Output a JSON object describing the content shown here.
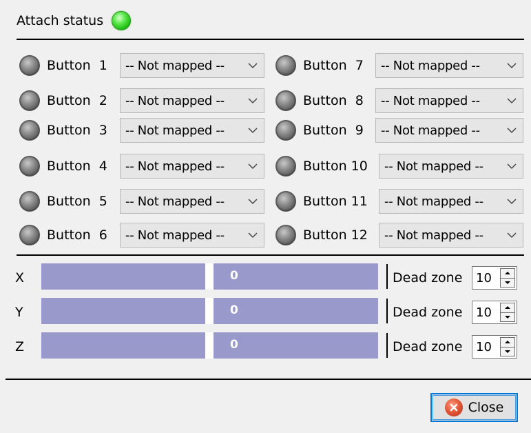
{
  "status": {
    "label": "Attach status",
    "led_color": "#33dd22"
  },
  "buttons_left": [
    {
      "label": "Button  1",
      "mapping": "-- Not mapped --"
    },
    {
      "label": "Button  2",
      "mapping": "-- Not mapped --"
    },
    {
      "label": "Button  3",
      "mapping": "-- Not mapped --"
    },
    {
      "label": "Button  4",
      "mapping": "-- Not mapped --"
    },
    {
      "label": "Button  5",
      "mapping": "-- Not mapped --"
    },
    {
      "label": "Button  6",
      "mapping": "-- Not mapped --"
    }
  ],
  "buttons_right": [
    {
      "label": "Button  7",
      "mapping": "-- Not mapped --"
    },
    {
      "label": "Button  8",
      "mapping": "-- Not mapped --"
    },
    {
      "label": "Button  9",
      "mapping": "-- Not mapped --"
    },
    {
      "label": "Button 10",
      "mapping": "-- Not mapped --"
    },
    {
      "label": "Button 11",
      "mapping": "-- Not mapped --"
    },
    {
      "label": "Button 12",
      "mapping": "-- Not mapped --"
    }
  ],
  "axes": [
    {
      "label": "X",
      "value": "0",
      "dead_zone_label": "Dead zone",
      "dead_zone": "10"
    },
    {
      "label": "Y",
      "value": "0",
      "dead_zone_label": "Dead zone",
      "dead_zone": "10"
    },
    {
      "label": "Z",
      "value": "0",
      "dead_zone_label": "Dead zone",
      "dead_zone": "10"
    }
  ],
  "footer": {
    "close_label": "Close"
  },
  "colors": {
    "axis_bar": "#9999cc",
    "focus_border": "#0078d7"
  }
}
